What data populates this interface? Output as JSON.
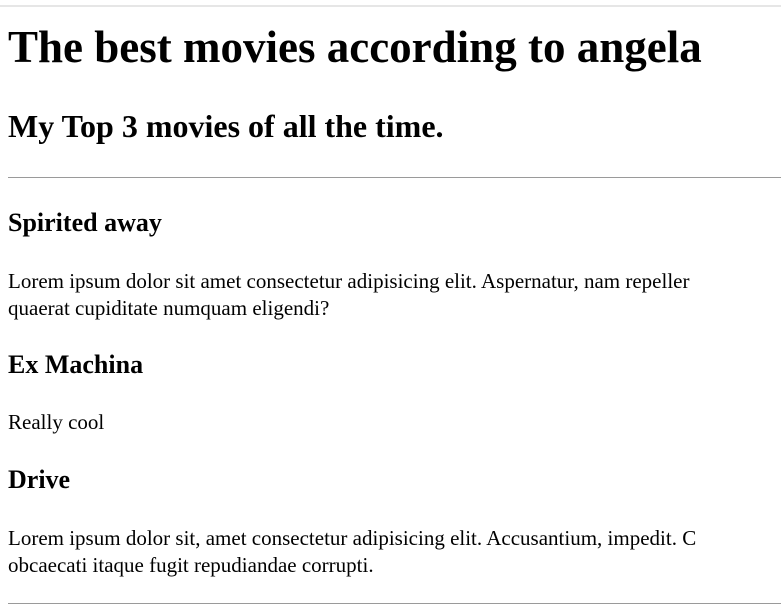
{
  "page": {
    "title": "The best movies according to angela",
    "subtitle": "My Top 3 movies of all the time."
  },
  "movies": [
    {
      "title": "Spirited away",
      "description_lines": [
        "Lorem ipsum dolor sit amet consectetur adipisicing elit. Aspernatur, nam repeller",
        "quaerat cupiditate numquam eligendi?"
      ]
    },
    {
      "title": "Ex Machina",
      "description_lines": [
        "Really cool"
      ]
    },
    {
      "title": "Drive",
      "description_lines": [
        "Lorem ipsum dolor sit, amet consectetur adipisicing elit. Accusantium, impedit. C",
        "obcaecati itaque fugit repudiandae corrupti."
      ]
    }
  ]
}
